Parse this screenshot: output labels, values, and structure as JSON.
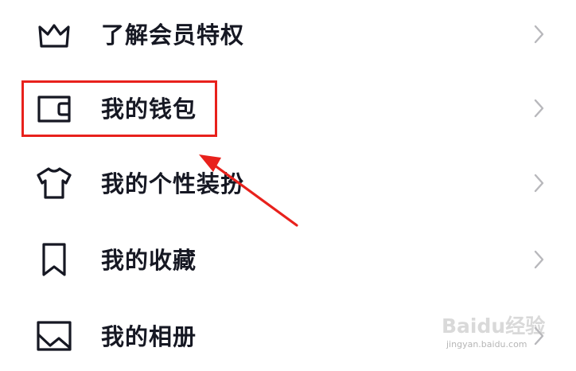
{
  "menu": {
    "items": [
      {
        "label": "了解会员特权",
        "icon": "crown-icon"
      },
      {
        "label": "我的钱包",
        "icon": "wallet-icon"
      },
      {
        "label": "我的个性装扮",
        "icon": "tshirt-icon"
      },
      {
        "label": "我的收藏",
        "icon": "bookmark-icon"
      },
      {
        "label": "我的相册",
        "icon": "photo-album-icon"
      }
    ],
    "chevron_icon": "chevron-right-icon"
  },
  "annotation": {
    "highlight_color": "#e8211c",
    "highlighted_item": "我的钱包"
  },
  "watermark": {
    "logo_text": "Baidu经验",
    "url": "jingyan.baidu.com"
  },
  "colors": {
    "text": "#161823",
    "chevron": "#b8b8bc",
    "background": "#ffffff"
  }
}
